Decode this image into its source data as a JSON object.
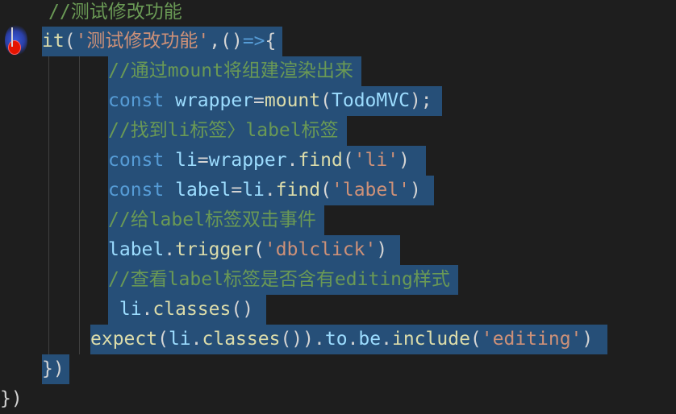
{
  "editor": {
    "lines": [
      {
        "tokens": [
          {
            "t": "//测试修改功能",
            "c": "cmt"
          }
        ]
      },
      {
        "tokens": [
          {
            "t": "it",
            "c": "fn"
          },
          {
            "t": "(",
            "c": "pun"
          },
          {
            "t": "'测试修改功能'",
            "c": "str"
          },
          {
            "t": ",()",
            "c": "pun"
          },
          {
            "t": "=>",
            "c": "kw"
          },
          {
            "t": "{",
            "c": "pun"
          }
        ]
      },
      {
        "tokens": [
          {
            "t": "//通过mount将组建渲染出来",
            "c": "cmt"
          }
        ]
      },
      {
        "tokens": [
          {
            "t": "const ",
            "c": "kw"
          },
          {
            "t": "wrapper",
            "c": "var"
          },
          {
            "t": "=",
            "c": "pun"
          },
          {
            "t": "mount",
            "c": "fn"
          },
          {
            "t": "(",
            "c": "pun"
          },
          {
            "t": "TodoMVC",
            "c": "var"
          },
          {
            "t": ");",
            "c": "pun"
          }
        ]
      },
      {
        "tokens": [
          {
            "t": "//找到li标签〉label标签",
            "c": "cmt"
          }
        ]
      },
      {
        "tokens": [
          {
            "t": "const ",
            "c": "kw"
          },
          {
            "t": "li",
            "c": "var"
          },
          {
            "t": "=",
            "c": "pun"
          },
          {
            "t": "wrapper",
            "c": "var"
          },
          {
            "t": ".",
            "c": "pun"
          },
          {
            "t": "find",
            "c": "fn"
          },
          {
            "t": "(",
            "c": "pun"
          },
          {
            "t": "'li'",
            "c": "str"
          },
          {
            "t": ")",
            "c": "pun"
          }
        ]
      },
      {
        "tokens": [
          {
            "t": "const ",
            "c": "kw"
          },
          {
            "t": "label",
            "c": "var"
          },
          {
            "t": "=",
            "c": "pun"
          },
          {
            "t": "li",
            "c": "var"
          },
          {
            "t": ".",
            "c": "pun"
          },
          {
            "t": "find",
            "c": "fn"
          },
          {
            "t": "(",
            "c": "pun"
          },
          {
            "t": "'label'",
            "c": "str"
          },
          {
            "t": ")",
            "c": "pun"
          }
        ]
      },
      {
        "tokens": [
          {
            "t": "//给label标签双击事件",
            "c": "cmt"
          }
        ]
      },
      {
        "tokens": [
          {
            "t": "label",
            "c": "var"
          },
          {
            "t": ".",
            "c": "pun"
          },
          {
            "t": "trigger",
            "c": "fn"
          },
          {
            "t": "(",
            "c": "pun"
          },
          {
            "t": "'dblclick'",
            "c": "str"
          },
          {
            "t": ")",
            "c": "pun"
          }
        ]
      },
      {
        "tokens": [
          {
            "t": "//查看label标签是否含有editing样式",
            "c": "cmt"
          }
        ]
      },
      {
        "tokens": [
          {
            "t": " li",
            "c": "var"
          },
          {
            "t": ".",
            "c": "pun"
          },
          {
            "t": "classes",
            "c": "fn"
          },
          {
            "t": "()",
            "c": "pun"
          }
        ]
      },
      {
        "tokens": [
          {
            "t": "expect",
            "c": "fn"
          },
          {
            "t": "(",
            "c": "pun"
          },
          {
            "t": "li",
            "c": "var"
          },
          {
            "t": ".",
            "c": "pun"
          },
          {
            "t": "classes",
            "c": "fn"
          },
          {
            "t": "())",
            "c": "pun"
          },
          {
            "t": ".",
            "c": "pun"
          },
          {
            "t": "to",
            "c": "var"
          },
          {
            "t": ".",
            "c": "pun"
          },
          {
            "t": "be",
            "c": "var"
          },
          {
            "t": ".",
            "c": "pun"
          },
          {
            "t": "include",
            "c": "fn"
          },
          {
            "t": "(",
            "c": "pun"
          },
          {
            "t": "'editing'",
            "c": "str"
          },
          {
            "t": ")",
            "c": "pun"
          }
        ]
      },
      {
        "tokens": [
          {
            "t": "})",
            "c": "pun"
          }
        ]
      },
      {
        "tokens": [
          {
            "t": "})",
            "c": "pun"
          }
        ]
      }
    ]
  },
  "colors": {
    "background": "#1e1e1e",
    "selection": "#264f78",
    "comment": "#6a9955",
    "keyword": "#569cd6",
    "variable": "#9cdcfe",
    "function": "#dcdcaa",
    "string": "#ce9178",
    "breakpoint": "#e51400"
  },
  "icons": {
    "gutter_marker": "breakpoint-icon"
  }
}
